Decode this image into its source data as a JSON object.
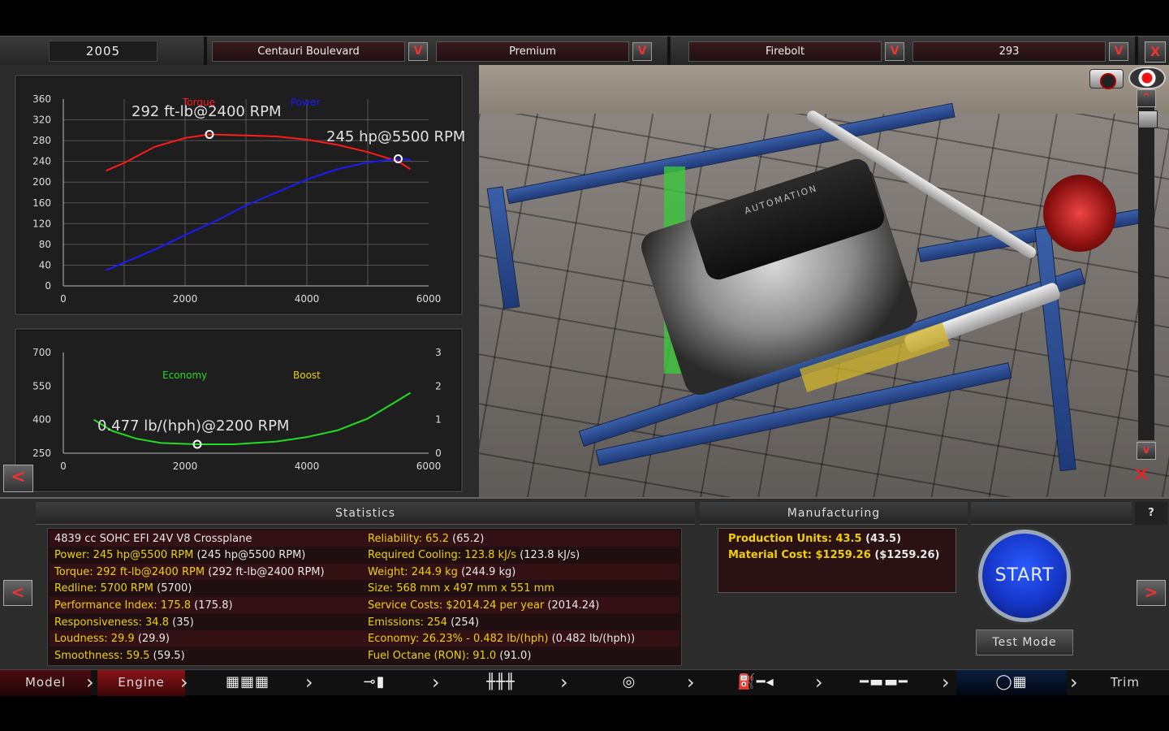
{
  "top_bar": {
    "year": "2005",
    "family_value": "Centauri Boulevard",
    "variant_value": "Premium",
    "model_value": "Firebolt",
    "trim_value": "293",
    "dropdown_glyph": "V",
    "close_glyph": "X"
  },
  "power_graph": {
    "legend_torque": "Torque",
    "legend_power": "Power",
    "torque_peak_label": "292 ft-lb@2400 RPM",
    "power_peak_label": "245 hp@5500 RPM",
    "y_ticks": [
      "360",
      "320",
      "280",
      "240",
      "200",
      "160",
      "120",
      "80",
      "40",
      "0"
    ],
    "x_ticks": [
      "0",
      "2000",
      "4000",
      "6000"
    ],
    "colors": {
      "torque": "#ff1a1a",
      "power": "#1a1aff"
    }
  },
  "economy_graph": {
    "legend_economy": "Economy",
    "legend_boost": "Boost",
    "economy_peak_label": "0.477 lb/(hph)@2200 RPM",
    "y_left_ticks": [
      "700",
      "550",
      "400",
      "250"
    ],
    "y_right_ticks": [
      "3",
      "2",
      "1",
      "0"
    ],
    "x_ticks": [
      "0",
      "2000",
      "4000",
      "6000"
    ],
    "colors": {
      "economy": "#22dd22",
      "boost": "#e6d000"
    }
  },
  "chart_data": [
    {
      "type": "line",
      "xlim": [
        0,
        6000
      ],
      "ylim": [
        0,
        360
      ],
      "series": [
        {
          "name": "Torque",
          "x": [
            700,
            1000,
            1500,
            2000,
            2400,
            3000,
            3500,
            4000,
            4500,
            5000,
            5500,
            5700
          ],
          "values": [
            222,
            237,
            268,
            285,
            292,
            290,
            288,
            282,
            272,
            258,
            240,
            225
          ]
        },
        {
          "name": "Power",
          "x": [
            700,
            1000,
            1500,
            2000,
            2500,
            3000,
            3500,
            4000,
            4500,
            5000,
            5500,
            5700
          ],
          "values": [
            30,
            45,
            70,
            98,
            125,
            155,
            180,
            205,
            225,
            238,
            245,
            243
          ]
        }
      ],
      "annotations": [
        "292 ft-lb@2400 RPM",
        "245 hp@5500 RPM"
      ]
    },
    {
      "type": "line",
      "xlim": [
        0,
        6000
      ],
      "ylim": [
        250,
        700
      ],
      "series": [
        {
          "name": "Economy",
          "x": [
            500,
            800,
            1200,
            1600,
            2200,
            2800,
            3500,
            4000,
            4500,
            5000,
            5400,
            5700
          ],
          "values": [
            400,
            350,
            315,
            296,
            290,
            290,
            302,
            322,
            352,
            405,
            470,
            520
          ]
        }
      ],
      "annotations": [
        "0.477 lb/(hph)@2200 RPM"
      ]
    }
  ],
  "statistics": {
    "title": "Statistics",
    "left": [
      {
        "label": "4839 cc SOHC EFI 24V V8 Crossplane",
        "value": ""
      },
      {
        "label": "Power: 245 hp@5500 RPM",
        "value": "(245 hp@5500 RPM)"
      },
      {
        "label": "Torque: 292 ft-lb@2400 RPM",
        "value": "(292 ft-lb@2400 RPM)"
      },
      {
        "label": "Redline: 5700 RPM",
        "value": "(5700)"
      },
      {
        "label": "Performance Index: 175.8",
        "value": "(175.8)"
      },
      {
        "label": "Responsiveness: 34.8",
        "value": "(35)"
      },
      {
        "label": "Loudness: 29.9",
        "value": "(29.9)"
      },
      {
        "label": "Smoothness: 59.5",
        "value": "(59.5)"
      }
    ],
    "right": [
      {
        "label": "Reliability: 65.2",
        "value": "(65.2)"
      },
      {
        "label": "Required Cooling: 123.8 kJ/s",
        "value": "(123.8 kJ/s)"
      },
      {
        "label": "Weight: 244.9 kg",
        "value": "(244.9 kg)"
      },
      {
        "label": "Size: 568 mm x 497 mm x 551 mm",
        "value": ""
      },
      {
        "label": "Service Costs: $2014.24 per year",
        "value": "(2014.24)"
      },
      {
        "label": "Emissions: 254",
        "value": "(254)"
      },
      {
        "label": "Economy: 26.23% - 0.482 lb/(hph)",
        "value": "(0.482 lb/(hph))"
      },
      {
        "label": "Fuel Octane (RON): 91.0",
        "value": "(91.0)"
      }
    ]
  },
  "manufacturing": {
    "title": "Manufacturing",
    "rows": [
      {
        "label": "Production Units: 43.5",
        "value": "(43.5)"
      },
      {
        "label": "Material Cost: $1259.26",
        "value": "($1259.26)"
      }
    ]
  },
  "actions": {
    "start_label": "START",
    "test_mode_label": "Test Mode",
    "help_label": "?",
    "prev_glyph": "<",
    "next_glyph": ">",
    "scroll_up_glyph": "^",
    "scroll_down_glyph": "v"
  },
  "viewport": {
    "engine_cover_text": "AUTOMATION"
  },
  "nav": {
    "model": "Model",
    "engine": "Engine",
    "trim": "Trim",
    "icons": [
      "block-icon",
      "head-icon",
      "intake-icon",
      "turbo-icon",
      "fuel-icon",
      "exhaust-icon",
      "dyno-icon"
    ]
  }
}
